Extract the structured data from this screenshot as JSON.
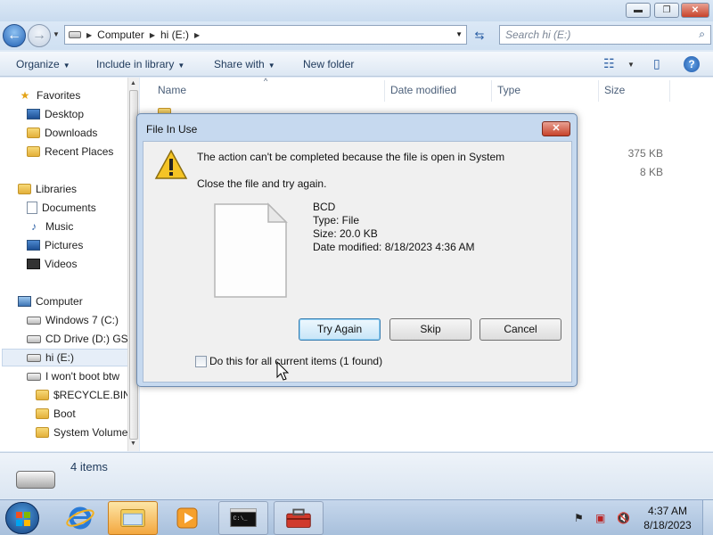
{
  "window": {
    "minimize": "▬",
    "maximize": "❐",
    "close": "✕"
  },
  "address": {
    "crumbs": [
      "Computer",
      "hi (E:)"
    ],
    "search_placeholder": "Search hi (E:)"
  },
  "toolbar": {
    "organize": "Organize",
    "include": "Include in library",
    "share": "Share with",
    "new_folder": "New folder"
  },
  "nav": {
    "favorites": "Favorites",
    "desktop": "Desktop",
    "downloads": "Downloads",
    "recent": "Recent Places",
    "libraries": "Libraries",
    "documents": "Documents",
    "music": "Music",
    "pictures": "Pictures",
    "videos": "Videos",
    "computer": "Computer",
    "win7": "Windows 7 (C:)",
    "cd": "CD Drive (D:) GSP",
    "hi": "hi (E:)",
    "iwont": "I won't boot btw",
    "recycle": "$RECYCLE.BIN",
    "boot": "Boot",
    "sysvol": "System Volume"
  },
  "columns": {
    "name": "Name",
    "date": "Date modified",
    "type": "Type",
    "size": "Size"
  },
  "files": {
    "size1": "375 KB",
    "size2": "8 KB"
  },
  "status": {
    "items": "4 items"
  },
  "dialog": {
    "title": "File In Use",
    "message": "The action can't be completed because the file is open in System",
    "instruction": "Close the file and try again.",
    "file_name": "BCD",
    "file_type": "Type: File",
    "file_size": "Size: 20.0 KB",
    "file_date": "Date modified: 8/18/2023 4:36 AM",
    "try_again": "Try Again",
    "skip": "Skip",
    "cancel": "Cancel",
    "checkbox_label": "Do this for all current items (1 found)",
    "close": "✕"
  },
  "taskbar": {
    "time": "4:37 AM",
    "date": "8/18/2023"
  },
  "colors": {
    "accent": "#1f5fb3",
    "dialog_frame": "#c6d9ef",
    "taskbar": "#b7cbe3"
  }
}
